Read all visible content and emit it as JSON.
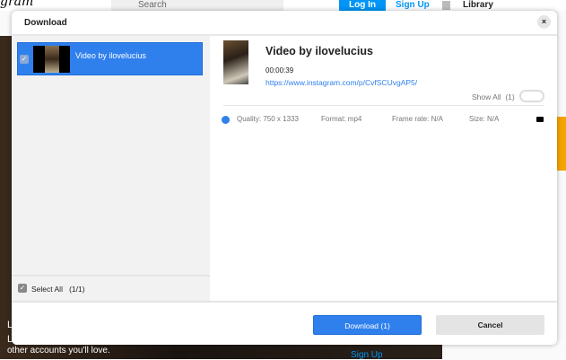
{
  "background": {
    "logo": "gram",
    "search_placeholder": "Search",
    "login": "Log In",
    "signup": "Sign Up",
    "library": "Library",
    "bottom_text": "other accounts you'll love.",
    "bottom_l1": "L",
    "bottom_l2": "L",
    "signup_bottom": "Sign Up"
  },
  "dialog": {
    "title": "Download",
    "close": "×",
    "items": [
      {
        "label": "Video by ilovelucius",
        "checked": true
      }
    ],
    "select_all": "Select All",
    "select_count": "(1/1)",
    "preview": {
      "title": "Video by ilovelucius",
      "duration": "00:00:39",
      "url": "https://www.instagram.com/p/CvfSCUvgAP5/",
      "show_all": "Show All",
      "show_all_count": "(1)",
      "show_all_on": false
    },
    "format": {
      "quality": "Quality: 750 x 1333",
      "format": "Format: mp4",
      "frame_rate": "Frame rate: N/A",
      "size": "Size: N/A"
    },
    "download_button": "Download (1)",
    "cancel_button": "Cancel"
  },
  "colors": {
    "accent": "#2f80ed"
  }
}
